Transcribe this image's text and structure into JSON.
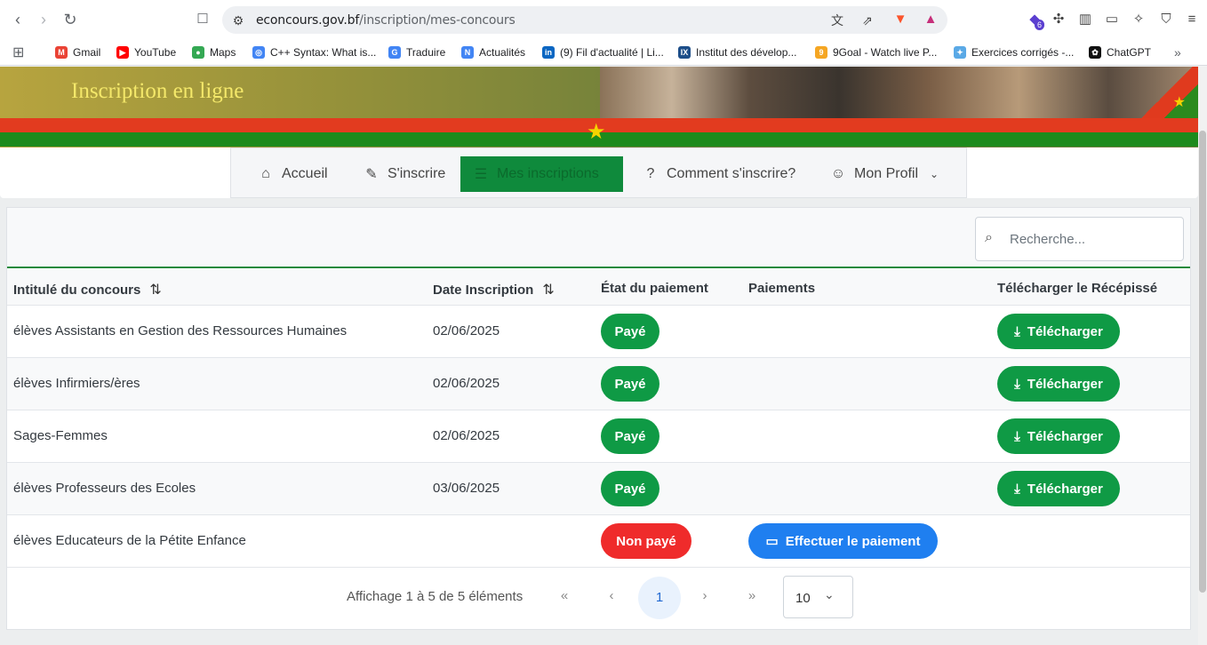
{
  "browser": {
    "url_host": "econcours.gov.bf",
    "url_path": "/inscription/mes-concours",
    "extension_badge": "6",
    "bookmarks": [
      {
        "label": "Gmail",
        "icon": "gmail-icon",
        "color": "#ea4335"
      },
      {
        "label": "YouTube",
        "icon": "youtube-icon",
        "color": "#ff0000"
      },
      {
        "label": "Maps",
        "icon": "maps-icon",
        "color": "#34a853"
      },
      {
        "label": "C++ Syntax: What is...",
        "icon": "globe-icon",
        "color": "#4285f4"
      },
      {
        "label": "Traduire",
        "icon": "translate-icon",
        "color": "#4285f4"
      },
      {
        "label": "Actualités",
        "icon": "news-icon",
        "color": "#4285f4"
      },
      {
        "label": "(9) Fil d'actualité | Li...",
        "icon": "linkedin-icon",
        "color": "#0a66c2"
      },
      {
        "label": "Institut des dévelop...",
        "icon": "ix-icon",
        "color": "#1d4e89"
      },
      {
        "label": "9Goal - Watch live P...",
        "icon": "ball-icon",
        "color": "#f5a623"
      },
      {
        "label": "Exercices corrigés -...",
        "icon": "puzzle-icon",
        "color": "#5aa9e6"
      },
      {
        "label": "ChatGPT",
        "icon": "chatgpt-icon",
        "color": "#111111"
      }
    ]
  },
  "banner": {
    "title": "Inscription en ligne"
  },
  "nav": {
    "items": [
      {
        "label": "Accueil",
        "icon": "home-icon"
      },
      {
        "label": "S'inscrire",
        "icon": "pencil-icon"
      },
      {
        "label": "Mes inscriptions",
        "icon": "list-icon"
      },
      {
        "label": "Comment s'inscrire?",
        "icon": "question-icon"
      },
      {
        "label": "Mon Profil",
        "icon": "user-icon"
      }
    ]
  },
  "search": {
    "placeholder": "Recherche..."
  },
  "table": {
    "headers": {
      "title": "Intitulé du concours",
      "date": "Date Inscription",
      "status": "État du paiement",
      "payments": "Paiements",
      "download": "Télécharger le Récépissé"
    },
    "rows": [
      {
        "title": "élèves Assistants en Gestion des Ressources Humaines",
        "date": "02/06/2025",
        "status": "Payé",
        "action": "Télécharger"
      },
      {
        "title": "élèves Infirmiers/ères",
        "date": "02/06/2025",
        "status": "Payé",
        "action": "Télécharger"
      },
      {
        "title": "Sages-Femmes",
        "date": "02/06/2025",
        "status": "Payé",
        "action": "Télécharger"
      },
      {
        "title": "élèves Professeurs des Ecoles",
        "date": "03/06/2025",
        "status": "Payé",
        "action": "Télécharger"
      },
      {
        "title": "élèves Educateurs de la Pétite Enfance",
        "date": "",
        "status": "Non payé",
        "pay_action": "Effectuer le paiement"
      }
    ]
  },
  "pager": {
    "summary": "Affichage 1 à 5 de 5 éléments",
    "current_page": "1",
    "page_size": "10"
  },
  "colors": {
    "accent_green": "#0f9a45",
    "unpaid_red": "#ef2b2b",
    "pay_blue": "#1f7ff0"
  }
}
